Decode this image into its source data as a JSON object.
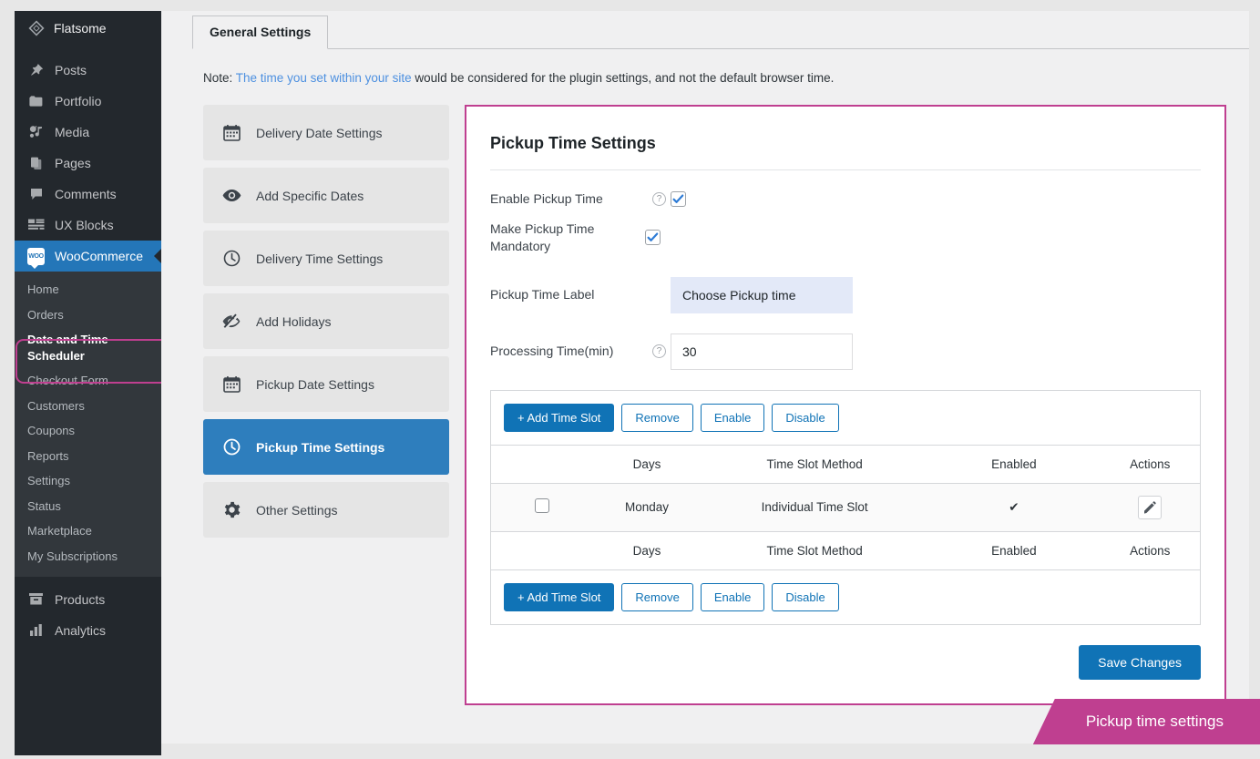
{
  "sidebar": {
    "brand": {
      "label": "Flatsome",
      "icon": "flatsome-diamond-icon"
    },
    "top_items": [
      {
        "label": "Posts",
        "icon": "pin-icon"
      },
      {
        "label": "Portfolio",
        "icon": "folder-icon"
      },
      {
        "label": "Media",
        "icon": "media-icon"
      },
      {
        "label": "Pages",
        "icon": "pages-icon"
      },
      {
        "label": "Comments",
        "icon": "comment-icon"
      },
      {
        "label": "UX Blocks",
        "icon": "ux-blocks-icon"
      }
    ],
    "current_item": {
      "label": "WooCommerce",
      "icon": "woocommerce-icon"
    },
    "submenu": [
      {
        "label": "Home",
        "active": false
      },
      {
        "label": "Orders",
        "active": false
      },
      {
        "label": "Date and Time Scheduler",
        "active": true
      },
      {
        "label": "Checkout Form",
        "active": false
      },
      {
        "label": "Customers",
        "active": false
      },
      {
        "label": "Coupons",
        "active": false
      },
      {
        "label": "Reports",
        "active": false
      },
      {
        "label": "Settings",
        "active": false
      },
      {
        "label": "Status",
        "active": false
      },
      {
        "label": "Marketplace",
        "active": false
      },
      {
        "label": "My Subscriptions",
        "active": false
      }
    ],
    "bottom_items": [
      {
        "label": "Products",
        "icon": "products-icon"
      },
      {
        "label": "Analytics",
        "icon": "analytics-icon"
      }
    ]
  },
  "tabs": [
    {
      "label": "General Settings",
      "active": true
    }
  ],
  "note": {
    "prefix": "Note:",
    "link": "The time you set within your site",
    "suffix": "would be considered for the plugin settings, and not the default browser time."
  },
  "settings_nav": [
    {
      "label": "Delivery Date Settings",
      "icon": "calendar-icon",
      "active": false
    },
    {
      "label": "Add Specific Dates",
      "icon": "eye-icon",
      "active": false
    },
    {
      "label": "Delivery Time Settings",
      "icon": "clock-icon",
      "active": false
    },
    {
      "label": "Add Holidays",
      "icon": "eye-slash-icon",
      "active": false
    },
    {
      "label": "Pickup Date Settings",
      "icon": "calendar-icon",
      "active": false
    },
    {
      "label": "Pickup Time Settings",
      "icon": "clock-icon",
      "active": true
    },
    {
      "label": "Other Settings",
      "icon": "gear-icon",
      "active": false
    }
  ],
  "panel": {
    "title": "Pickup Time Settings",
    "fields": {
      "enable_pickup_time": {
        "label": "Enable Pickup Time",
        "has_help": true,
        "checked": true
      },
      "make_mandatory": {
        "label": "Make Pickup Time Mandatory",
        "has_help": false,
        "checked": true
      },
      "pickup_time_label": {
        "label": "Pickup Time Label",
        "has_help": false,
        "value": "Choose Pickup time",
        "placeholder": "Choose Pickup time"
      },
      "processing_time": {
        "label": "Processing Time(min)",
        "has_help": true,
        "value": "30",
        "placeholder": "30"
      }
    },
    "toolbar": {
      "add_label": "+ Add Time Slot",
      "remove_label": "Remove",
      "enable_label": "Enable",
      "disable_label": "Disable"
    },
    "table": {
      "columns": [
        "",
        "Days",
        "Time Slot Method",
        "Enabled",
        "Actions"
      ],
      "rows": [
        {
          "selected": false,
          "days": "Monday",
          "method": "Individual Time Slot",
          "enabled": "✔",
          "action_icon": "edit-pencil-icon"
        }
      ]
    },
    "save_label": "Save Changes"
  },
  "callout": {
    "label": "Pickup time settings"
  },
  "colors": {
    "accent_pink": "#bf3f90",
    "accent_blue": "#1073b6",
    "nav_active_blue": "#2e7ebd",
    "sidebar_bg": "#23282d",
    "submenu_bg": "#32373c",
    "link_blue": "#4d90e0",
    "tinted_input": "#e3e9f8"
  }
}
